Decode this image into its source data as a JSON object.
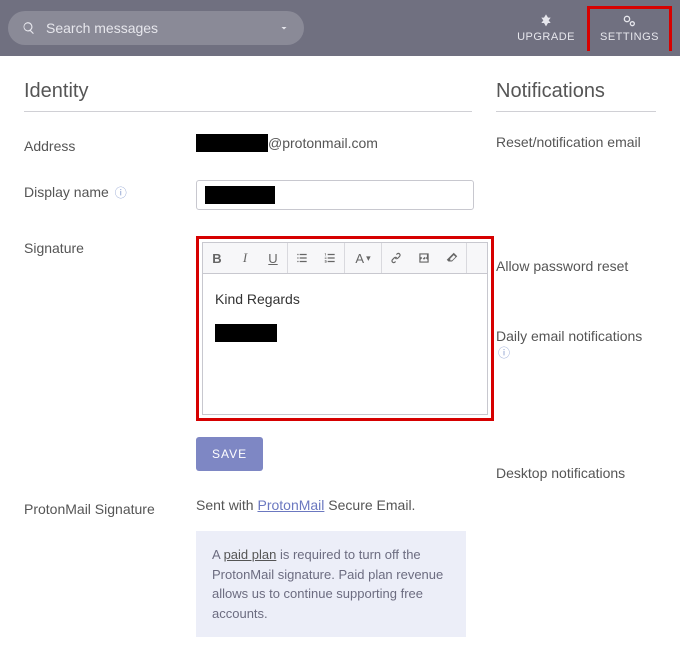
{
  "topbar": {
    "search_placeholder": "Search messages",
    "upgrade_label": "UPGRADE",
    "settings_label": "SETTINGS"
  },
  "identity": {
    "heading": "Identity",
    "address_label": "Address",
    "address_domain": "@protonmail.com",
    "display_name_label": "Display name",
    "signature_label": "Signature",
    "signature_text": "Kind Regards",
    "save_label": "SAVE",
    "pm_signature_label": "ProtonMail Signature",
    "pm_signature_prefix": "Sent with ",
    "pm_signature_link": "ProtonMail",
    "pm_signature_suffix": " Secure Email.",
    "notice_prefix": "A ",
    "notice_link": "paid plan",
    "notice_suffix": " is required to turn off the ProtonMail signature. Paid plan revenue allows us to continue supporting free accounts."
  },
  "notifications": {
    "heading": "Notifications",
    "reset_label": "Reset/notification email",
    "allow_reset_label": "Allow password reset",
    "daily_label": "Daily email notifications",
    "desktop_label": "Desktop notifications"
  }
}
